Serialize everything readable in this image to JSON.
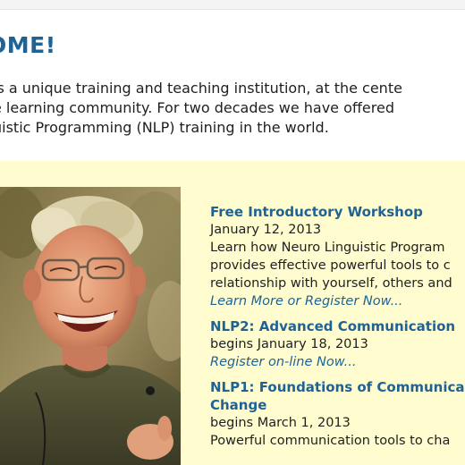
{
  "heading": "OME!",
  "intro": {
    "lines": [
      "is a unique training and teaching institution, at the cente",
      "e learning community. For two decades we have offered",
      "uistic Programming (NLP) training in the world."
    ]
  },
  "events": [
    {
      "title": "Free Introductory Workshop",
      "date": "January 12, 2013",
      "desc": [
        "Learn how Neuro Linguistic Program",
        "provides effective powerful tools to c",
        "relationship with yourself, others and"
      ],
      "link": "Learn More or Register Now..."
    },
    {
      "title": "NLP2: Advanced Communication",
      "date": "begins January 18, 2013",
      "link": "Register on-line Now..."
    },
    {
      "title_lines": [
        "NLP1: Foundations of Communica",
        "Change"
      ],
      "date": "begins March 1, 2013",
      "desc": [
        "Powerful communication tools to cha"
      ]
    }
  ],
  "colors": {
    "heading": "#1f6394",
    "panel": "#fffdcf",
    "text": "#1f1f1f"
  },
  "photo": {
    "icon": "laughing-man-photo"
  }
}
